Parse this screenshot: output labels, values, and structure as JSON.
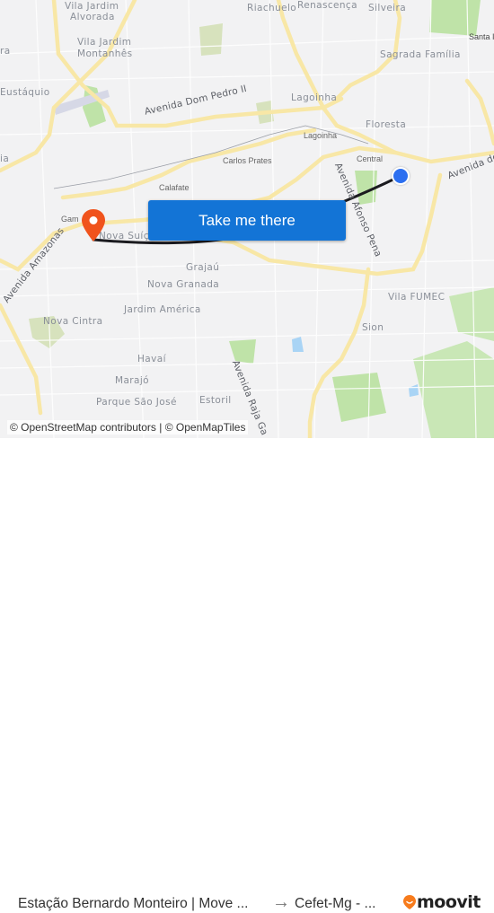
{
  "map": {
    "labels": {
      "vila_jardim_alvorada": "Vila Jardim\nAlvorada",
      "vila_jardim_alvorada_1": "Vila Jardim",
      "vila_jardim_alvorada_2": "Alvorada",
      "vila_jardim_montanhes_1": "Vila Jardim",
      "vila_jardim_montanhes_2": "Montanhês",
      "eustaquio": "Eustáquio",
      "riachuelo": "Riachuelo",
      "renascenca": "Renascença",
      "silveira": "Silveira",
      "santa": "Santa I",
      "sagrada_familia": "Sagrada Família",
      "lagoinha": "Lagoinha",
      "lagoinha_small": "Lagoinha",
      "floresta": "Floresta",
      "central": "Central",
      "carlos_prates": "Carlos Prates",
      "calafate": "Calafate",
      "gameleira": "Gam",
      "nova_suica": "Nova Suíça",
      "grajau": "Grajaú",
      "nova_granada": "Nova Granada",
      "jardim_america": "Jardim América",
      "nova_cintra": "Nova Cintra",
      "havai": "Havaí",
      "marajo": "Marajó",
      "parque_sao_jose": "Parque São José",
      "estoril": "Estoril",
      "vila_fumec": "Vila FUMEC",
      "sion": "Sion",
      "ia": "ia",
      "ra": "ra"
    },
    "roads": {
      "dom_pedro": "Avenida Dom Pedro II",
      "afonso_pena": "Avenida Afonso Pena",
      "amazonas": "Avenida Amazonas",
      "raja": "Avenida Raja Ga",
      "avenida_dos": "Avenida dos"
    },
    "attribution": "© OpenStreetMap contributors | © OpenMapTiles",
    "colors": {
      "route": "#1b1b1f",
      "origin_pin": "#2c6ff0",
      "destination_pin": "#f0531c",
      "cta": "#1374d6"
    }
  },
  "cta_button": "Take me there",
  "footer": {
    "origin": "Estação Bernardo Monteiro | Move ...",
    "arrow": "→",
    "destination": "Cefet-Mg - ...",
    "brand": "moovit"
  }
}
